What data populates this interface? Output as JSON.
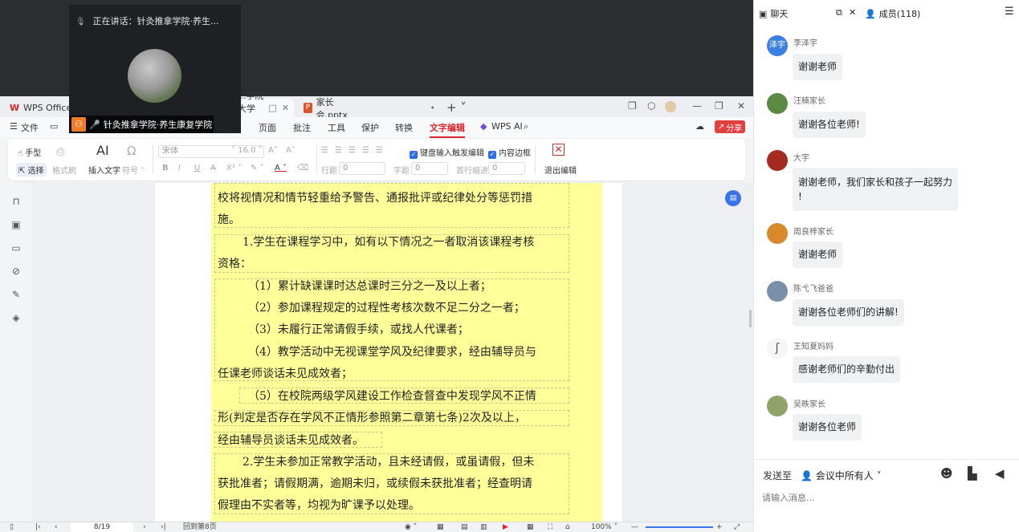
{
  "meeting": {
    "speaking_label": "正在讲话：针灸推拿学院·养生...",
    "participant_name": "针灸推拿学院·养生康复学院"
  },
  "wps": {
    "tabs": [
      {
        "label": "WPS Office"
      },
      {
        "label": "...学院大学本..."
      },
      {
        "label": "家长会.pptx"
      }
    ],
    "menu": {
      "file": "文件",
      "items": [
        "页面",
        "批注",
        "工具",
        "保护",
        "转换",
        "文字编辑"
      ],
      "wps_ai": "WPS AI",
      "share": "分享"
    },
    "ribbon": {
      "hand": "手型",
      "select": "选择",
      "format_brush": "格式刷",
      "insert_text": "插入文字",
      "symbol": "符号",
      "font_name": "宋体",
      "font_size": "16.0",
      "line_spacing_label": "行距",
      "line_spacing_value": "0",
      "char_spacing_label": "字距",
      "char_spacing_value": "0",
      "indent_label": "首行缩进",
      "indent_value": "0",
      "keyboard_trigger": "键盘输入触发编辑",
      "content_border": "内容边框",
      "exit_edit": "退出编辑"
    },
    "document": {
      "lines": [
        "校将视情况和情节轻重给予警告、通报批评或纪律处分等惩罚措",
        "施。",
        "1.学生在课程学习中，如有以下情况之一者取消该课程考核",
        "资格：",
        "（1）累计缺课课时达总课时三分之一及以上者；",
        "（2）参加课程规定的过程性考核次数不足二分之一者；",
        "（3）未履行正常请假手续，或找人代课者；",
        "（4）教学活动中无视课堂学风及纪律要求，经由辅导员与",
        "任课老师谈话未见成效者；",
        "（5）在校院两级学风建设工作检查督查中发现学风不正情",
        "形(判定是否存在学风不正情形参照第二章第七条)2次及以上，",
        "经由辅导员谈话未见成效者。",
        "2.学生未参加正常教学活动，且未经请假，或虽请假，但未",
        "获批准者；请假期满，逾期未归，或续假未获批准者；经查明请",
        "假理由不实者等，均视为旷课予以处理。"
      ]
    },
    "status": {
      "page": "8/19",
      "jump": "回到第8页",
      "zoom": "100%"
    }
  },
  "chat": {
    "tab_chat": "聊天",
    "tab_members": "成员(118)",
    "messages": [
      {
        "avatar_text": "泽宇",
        "avatar_color": "#3b7fe0",
        "name": "李泽宇",
        "text": "谢谢老师"
      },
      {
        "avatar_text": "",
        "avatar_color": "#5b8a45",
        "name": "汪楠家长",
        "text": "谢谢各位老师!"
      },
      {
        "avatar_text": "",
        "avatar_color": "#a52a1f",
        "name": "大宇",
        "text": "谢谢老师，我们家长和孩子一起努力"
      },
      {
        "avatar_text": "",
        "avatar_color": "#d8892b",
        "name": "周良梓家长",
        "text": "谢谢老师"
      },
      {
        "avatar_text": "",
        "avatar_color": "#7a8fa8",
        "name": "陈弋飞爸爸",
        "text": "谢谢各位老师们的讲解!"
      },
      {
        "avatar_text": "",
        "avatar_color": "#f5f5f5",
        "name": "王知夏妈妈",
        "text": "感谢老师们的辛勤付出"
      },
      {
        "avatar_text": "",
        "avatar_color": "#8fa36b",
        "name": "吴昳家长",
        "text": "谢谢各位老师"
      }
    ],
    "bubble3_line2": "!",
    "send_to_label": "发送至",
    "send_target": "会议中所有人",
    "input_placeholder": "请输入消息..."
  }
}
